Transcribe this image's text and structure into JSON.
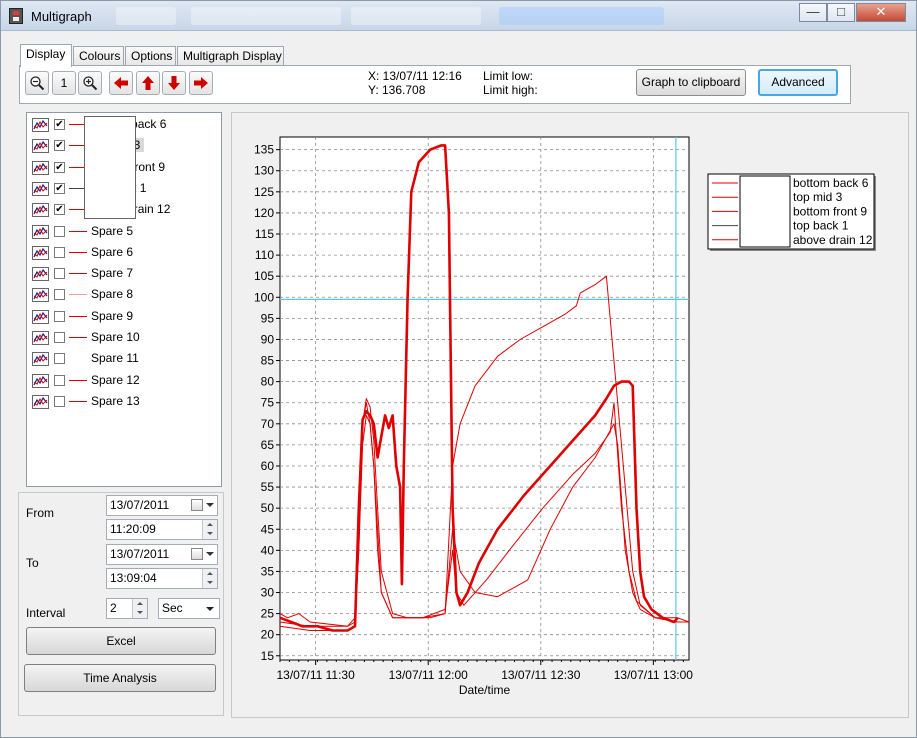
{
  "window": {
    "title": "Multigraph",
    "controls": {
      "minimize": "—",
      "maximize": "□",
      "close": "✕"
    }
  },
  "tabs": [
    {
      "label": "Display",
      "active": true
    },
    {
      "label": "Colours",
      "active": false
    },
    {
      "label": "Options",
      "active": false
    },
    {
      "label": "Multigraph Display",
      "active": false
    }
  ],
  "toolbar": {
    "zoom_out_icon": "magnifier-minus-icon",
    "zoom_reset_label": "1",
    "zoom_in_icon": "magnifier-plus-icon",
    "pan_icons": [
      "arrow-left-icon",
      "arrow-up-icon",
      "arrow-down-icon",
      "arrow-right-icon"
    ],
    "cursor_x": "X: 13/07/11 12:16",
    "cursor_y": "Y: 136.708",
    "limit_low": "Limit low:",
    "limit_high": "Limit high:",
    "clipboard_button": "Graph to clipboard",
    "advanced_button": "Advanced"
  },
  "channels": [
    {
      "label": "bottom back 6",
      "checked": true,
      "color": "#e00000",
      "selected": false
    },
    {
      "label": "top mid 3",
      "checked": true,
      "color": "#e00000",
      "selected": true
    },
    {
      "label": "bottom front 9",
      "checked": true,
      "color": "#e00000",
      "selected": false
    },
    {
      "label": "top back 1",
      "checked": true,
      "color": "#444444",
      "selected": false
    },
    {
      "label": "above drain 12",
      "checked": true,
      "color": "#e00000",
      "selected": false
    },
    {
      "label": "Spare 5",
      "checked": false,
      "color": "#e00000",
      "selected": false
    },
    {
      "label": "Spare 6",
      "checked": false,
      "color": "#e00000",
      "selected": false
    },
    {
      "label": "Spare 7",
      "checked": false,
      "color": "#e00000",
      "selected": false
    },
    {
      "label": "Spare 8",
      "checked": false,
      "color": "#f0a0a0",
      "selected": false
    },
    {
      "label": "Spare 9",
      "checked": false,
      "color": "#e00000",
      "selected": false
    },
    {
      "label": "Spare 10",
      "checked": false,
      "color": "#e00000",
      "selected": false
    },
    {
      "label": "Spare 11",
      "checked": false,
      "color": "#ffffff",
      "selected": false
    },
    {
      "label": "Spare 12",
      "checked": false,
      "color": "#e00000",
      "selected": false
    },
    {
      "label": "Spare 13",
      "checked": false,
      "color": "#e00000",
      "selected": false
    }
  ],
  "range": {
    "from_label": "From",
    "from_date": "13/07/2011",
    "from_time": "11:20:09",
    "to_label": "To",
    "to_date": "13/07/2011",
    "to_time": "13:09:04",
    "interval_label": "Interval",
    "interval_value": "2",
    "interval_unit": "Sec"
  },
  "buttons": {
    "excel": "Excel",
    "time_analysis": "Time Analysis"
  },
  "colors": {
    "series": "#e00000",
    "limit_line": "#5bc8e8",
    "cursor_line": "#5bc8e8"
  },
  "chart_data": {
    "type": "line",
    "title": "",
    "xlabel": "Date/time",
    "ylabel": "",
    "x_ticks": [
      "13/07/11 11:30",
      "13/07/11 12:00",
      "13/07/11 12:30",
      "13/07/11 13:00"
    ],
    "y_ticks": [
      15,
      20,
      25,
      30,
      35,
      40,
      45,
      50,
      55,
      60,
      65,
      70,
      75,
      80,
      85,
      90,
      95,
      100,
      105,
      110,
      115,
      120,
      125,
      130,
      135
    ],
    "xlim_minutes": [
      0,
      109
    ],
    "ylim": [
      14,
      138
    ],
    "grid": true,
    "limit_line_y": 99.5,
    "cursor_x_minutes": 105.5,
    "legend": {
      "placement": "right",
      "entries": [
        "bottom back 6",
        "top mid 3",
        "bottom front 9",
        "top back 1",
        "above drain 12"
      ]
    },
    "series": [
      {
        "name": "top mid 3",
        "width": 2.6,
        "points": [
          [
            0,
            24
          ],
          [
            3,
            23
          ],
          [
            6,
            22
          ],
          [
            10,
            22
          ],
          [
            14,
            21
          ],
          [
            18,
            21
          ],
          [
            20,
            22
          ],
          [
            21,
            50
          ],
          [
            22,
            71
          ],
          [
            23,
            73
          ],
          [
            24,
            72
          ],
          [
            25,
            70
          ],
          [
            26,
            62
          ],
          [
            27,
            67
          ],
          [
            28,
            72
          ],
          [
            29,
            69
          ],
          [
            30,
            72
          ],
          [
            31,
            60
          ],
          [
            32,
            55
          ],
          [
            32.5,
            32
          ],
          [
            33,
            60
          ],
          [
            34,
            100
          ],
          [
            35,
            125
          ],
          [
            37,
            132
          ],
          [
            40,
            135
          ],
          [
            43,
            136
          ],
          [
            44,
            136
          ],
          [
            45,
            120
          ],
          [
            46,
            50
          ],
          [
            47,
            30
          ],
          [
            48,
            27
          ],
          [
            50,
            30
          ],
          [
            53,
            37
          ],
          [
            58,
            45
          ],
          [
            65,
            53
          ],
          [
            72,
            60
          ],
          [
            80,
            68
          ],
          [
            84,
            72
          ],
          [
            87,
            76
          ],
          [
            89,
            79
          ],
          [
            91,
            80
          ],
          [
            93,
            80
          ],
          [
            94,
            79
          ],
          [
            95,
            50
          ],
          [
            96,
            35
          ],
          [
            97,
            29
          ],
          [
            99,
            26
          ],
          [
            102,
            24
          ],
          [
            105,
            23
          ],
          [
            106,
            24
          ]
        ]
      },
      {
        "name": "bottom back 6",
        "width": 1,
        "points": [
          [
            0,
            23
          ],
          [
            8,
            22
          ],
          [
            18,
            22
          ],
          [
            20,
            24
          ],
          [
            21,
            45
          ],
          [
            22,
            70
          ],
          [
            23,
            76
          ],
          [
            24,
            74
          ],
          [
            25,
            66
          ],
          [
            26,
            50
          ],
          [
            27,
            35
          ],
          [
            30,
            25
          ],
          [
            34,
            24
          ],
          [
            40,
            24
          ],
          [
            44,
            25
          ],
          [
            46,
            60
          ],
          [
            48,
            70
          ],
          [
            52,
            79
          ],
          [
            58,
            86
          ],
          [
            64,
            90
          ],
          [
            70,
            93
          ],
          [
            76,
            96
          ],
          [
            79,
            98
          ],
          [
            80,
            101
          ],
          [
            84,
            103
          ],
          [
            87,
            105
          ],
          [
            90,
            75
          ],
          [
            92,
            55
          ],
          [
            94,
            35
          ],
          [
            96,
            27
          ],
          [
            100,
            24
          ],
          [
            106,
            23
          ],
          [
            109,
            23
          ]
        ]
      },
      {
        "name": "bottom front 9",
        "width": 1,
        "points": [
          [
            0,
            22
          ],
          [
            8,
            21
          ],
          [
            18,
            21
          ],
          [
            20,
            22
          ],
          [
            21,
            40
          ],
          [
            22,
            65
          ],
          [
            23,
            72
          ],
          [
            24,
            70
          ],
          [
            25,
            60
          ],
          [
            26,
            45
          ],
          [
            27,
            30
          ],
          [
            30,
            24
          ],
          [
            38,
            24
          ],
          [
            44,
            26
          ],
          [
            46,
            40
          ],
          [
            47,
            30
          ],
          [
            49,
            27
          ],
          [
            55,
            33
          ],
          [
            62,
            41
          ],
          [
            70,
            50
          ],
          [
            78,
            58
          ],
          [
            84,
            63
          ],
          [
            88,
            68
          ],
          [
            89,
            75
          ],
          [
            91,
            50
          ],
          [
            93,
            35
          ],
          [
            95,
            28
          ],
          [
            100,
            24
          ],
          [
            106,
            23
          ],
          [
            109,
            23
          ]
        ]
      },
      {
        "name": "above drain 12",
        "width": 1,
        "points": [
          [
            0,
            25
          ],
          [
            2,
            24
          ],
          [
            5,
            25
          ],
          [
            8,
            23
          ],
          [
            18,
            22
          ],
          [
            20,
            23
          ],
          [
            21,
            40
          ],
          [
            22,
            70
          ],
          [
            23,
            75
          ],
          [
            24,
            70
          ],
          [
            25,
            60
          ],
          [
            26,
            40
          ],
          [
            27,
            30
          ],
          [
            30,
            24
          ],
          [
            38,
            24
          ],
          [
            44,
            25
          ],
          [
            46,
            45
          ],
          [
            48,
            35
          ],
          [
            52,
            30
          ],
          [
            58,
            29
          ],
          [
            66,
            33
          ],
          [
            72,
            45
          ],
          [
            78,
            55
          ],
          [
            84,
            62
          ],
          [
            89,
            70
          ],
          [
            90,
            65
          ],
          [
            92,
            40
          ],
          [
            94,
            30
          ],
          [
            96,
            26
          ],
          [
            100,
            24
          ],
          [
            106,
            24
          ],
          [
            109,
            23
          ]
        ]
      }
    ]
  }
}
